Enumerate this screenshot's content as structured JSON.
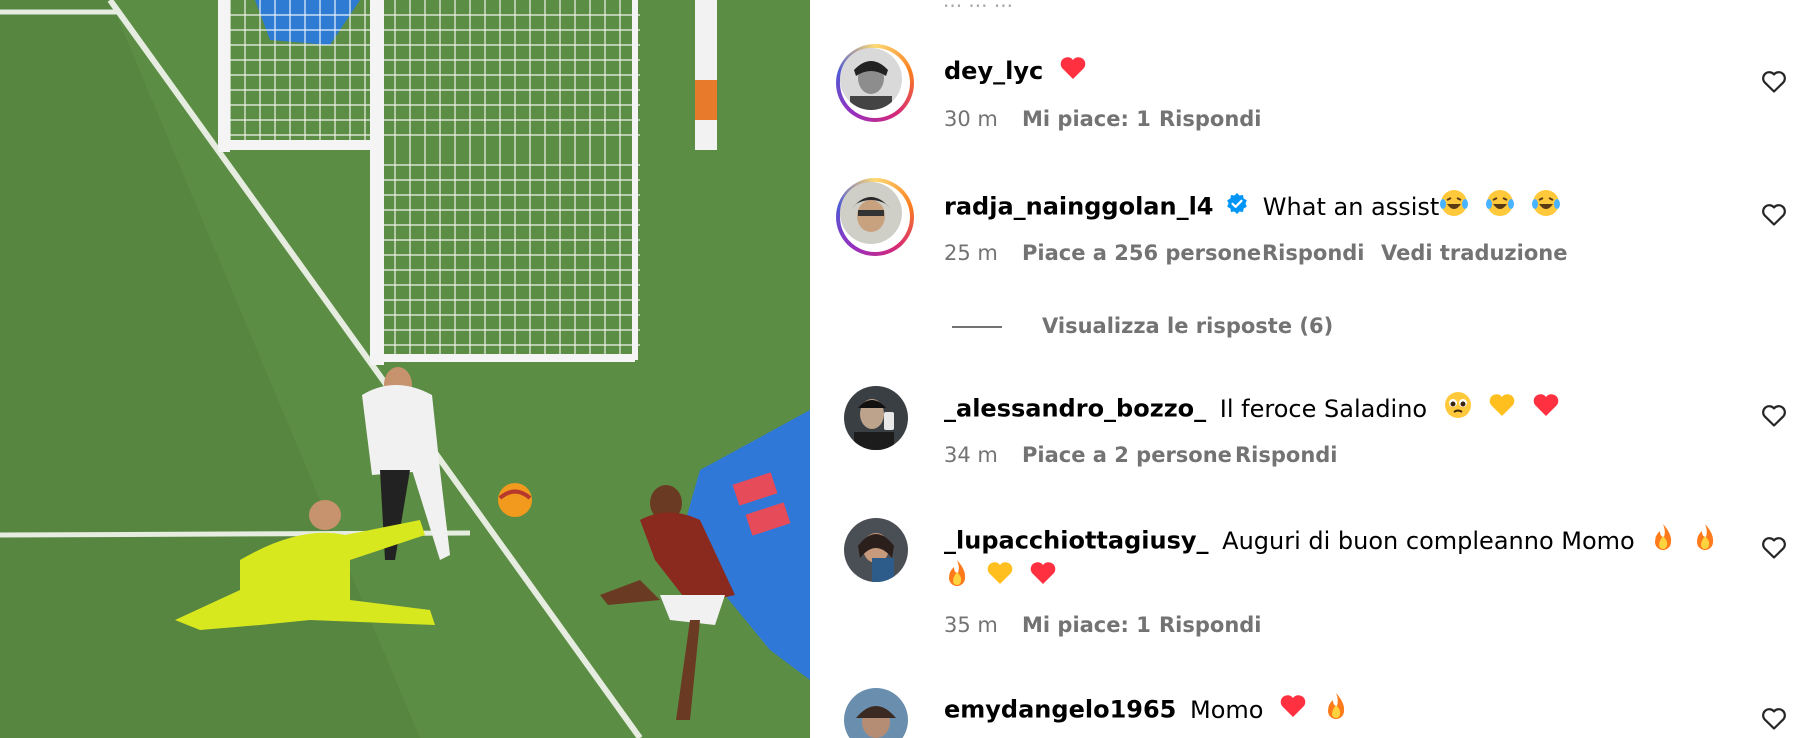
{
  "post": {
    "media_alt": "football-goal-image"
  },
  "partial_text_top": "... ... ...",
  "comments": [
    {
      "username": "dey_lyc",
      "text": "",
      "emojis": [
        "heart"
      ],
      "time": "30 m",
      "likes": "Mi piace: 1",
      "reply": "Rispondi",
      "translate": ""
    },
    {
      "username": "radja_nainggolan_l4",
      "verified": true,
      "text": "What an assist",
      "emojis": [
        "laughing-tears",
        "laughing-tears",
        "laughing-tears"
      ],
      "time": "25 m",
      "likes": "Piace a 256 persone",
      "reply": "Rispondi",
      "translate": "Vedi traduzione",
      "replies_label": "Visualizza le risposte (6)"
    },
    {
      "username": "_alessandro_bozzo_",
      "text": "Il feroce Saladino",
      "emojis": [
        "pleading-face",
        "yellow-heart",
        "heart"
      ],
      "time": "34 m",
      "likes": "Piace a 2 persone",
      "reply": "Rispondi"
    },
    {
      "username": "_lupacchiottagiusy_",
      "text": "Auguri di buon compleanno Momo",
      "emojis": [
        "fire",
        "fire"
      ],
      "emojis_line2": [
        "fire",
        "yellow-heart",
        "heart"
      ],
      "time": "35 m",
      "likes": "Mi piace: 1",
      "reply": "Rispondi"
    },
    {
      "username": "emydangelo1965",
      "text": "Momo",
      "emojis": [
        "heart",
        "fire"
      ]
    }
  ],
  "colors": {
    "meta_gray": "#737373",
    "heart_red": "#ff3040",
    "verified_blue": "#0095f6"
  }
}
